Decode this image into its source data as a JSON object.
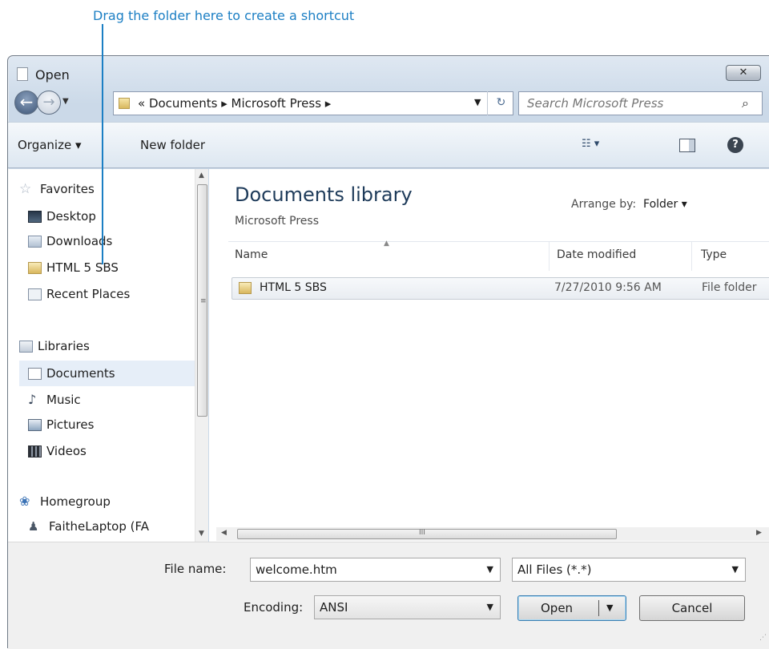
{
  "callout": {
    "text": "Drag the folder here to create a shortcut"
  },
  "window": {
    "title": "Open",
    "close_label": "✕"
  },
  "address": {
    "path": "« Documents ▸ Microsoft Press ▸",
    "search_placeholder": "Search Microsoft Press"
  },
  "toolbar": {
    "organize": "Organize ▾",
    "new_folder": "New folder",
    "views": "☷ ▾"
  },
  "sidebar": {
    "favorites": "Favorites",
    "desktop": "Desktop",
    "downloads": "Downloads",
    "html5sbs": "HTML 5 SBS",
    "recent": "Recent Places",
    "libraries": "Libraries",
    "documents": "Documents",
    "music": "Music",
    "pictures": "Pictures",
    "videos": "Videos",
    "homegroup": "Homegroup",
    "laptop": "FaitheLaptop (FA"
  },
  "content": {
    "title": "Documents library",
    "subtitle": "Microsoft Press",
    "arrange_label": "Arrange by:",
    "arrange_value": "Folder ▾",
    "columns": {
      "name": "Name",
      "date": "Date modified",
      "type": "Type"
    },
    "files": [
      {
        "name": "HTML 5 SBS",
        "date": "7/27/2010 9:56 AM",
        "type": "File folder"
      }
    ]
  },
  "bottom": {
    "file_name_label": "File name:",
    "file_name_value": "welcome.htm",
    "file_type_value": "All Files  (*.*)",
    "encoding_label": "Encoding:",
    "encoding_value": "ANSI",
    "open_label": "Open",
    "cancel_label": "Cancel"
  }
}
